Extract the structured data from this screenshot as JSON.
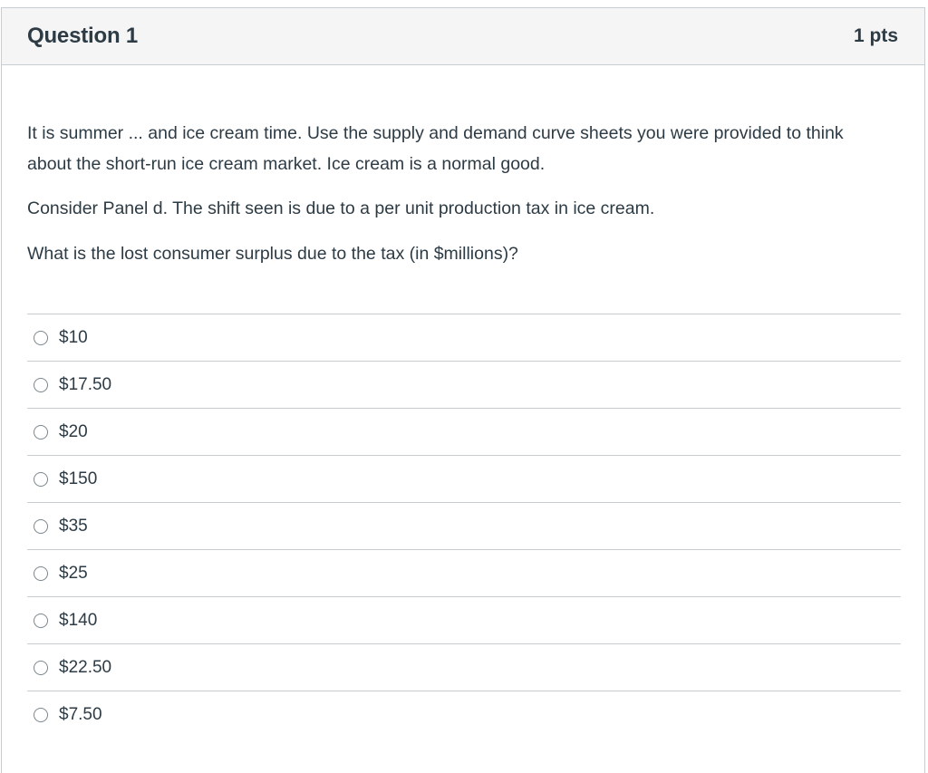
{
  "question": {
    "title": "Question 1",
    "points": "1 pts",
    "paragraphs": [
      "It is summer ... and ice cream time. Use the supply and demand curve sheets you were provided to think about the short-run ice cream market. Ice cream is a normal good.",
      "Consider Panel d. The shift seen is due to a per unit production tax in ice cream.",
      "What is the lost consumer surplus due to the tax (in $millions)?"
    ],
    "answers": [
      {
        "label": "$10"
      },
      {
        "label": "$17.50"
      },
      {
        "label": "$20"
      },
      {
        "label": "$150"
      },
      {
        "label": "$35"
      },
      {
        "label": "$25"
      },
      {
        "label": "$140"
      },
      {
        "label": "$22.50"
      },
      {
        "label": "$7.50"
      }
    ]
  }
}
